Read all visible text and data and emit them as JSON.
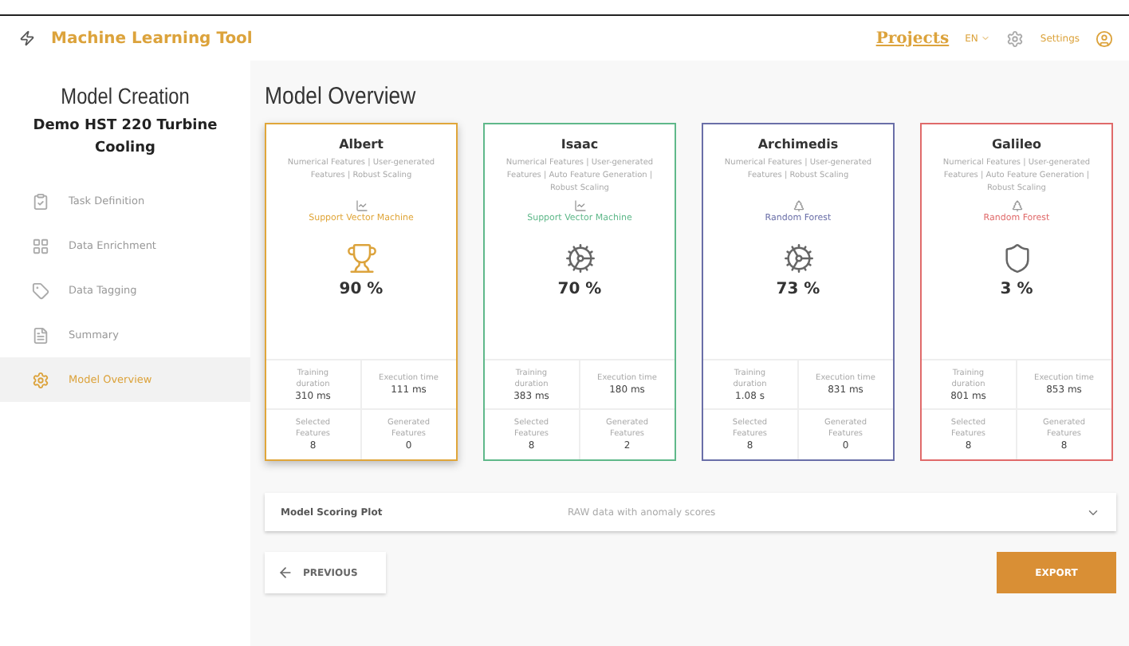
{
  "app": {
    "title": "Machine Learning Tool"
  },
  "header": {
    "projects_link": "Projects",
    "language": "EN",
    "settings": "Settings"
  },
  "sidebar": {
    "title": "Model Creation",
    "project": "Demo HST 220 Turbine Cooling",
    "items": [
      {
        "label": "Task Definition",
        "selected": false
      },
      {
        "label": "Data Enrichment",
        "selected": false
      },
      {
        "label": "Data Tagging",
        "selected": false
      },
      {
        "label": "Summary",
        "selected": false
      },
      {
        "label": "Model Overview",
        "selected": true
      }
    ]
  },
  "page_title": "Model Overview",
  "models": [
    {
      "name": "Albert",
      "features": "Numerical Features | User-generated Features | Robust Scaling",
      "algorithm": "Support Vector Machine",
      "score": "90 %",
      "color": "#e0a63a",
      "selected": true,
      "metrics": [
        {
          "label": "Training duration",
          "value": "310 ms"
        },
        {
          "label": "Execution time",
          "value": "111 ms"
        },
        {
          "label": "Selected Features",
          "value": "8"
        },
        {
          "label": "Generated Features",
          "value": "0"
        }
      ]
    },
    {
      "name": "Isaac",
      "features": "Numerical Features | User-generated Features | Auto Feature Generation | Robust Scaling",
      "algorithm": "Support Vector Machine",
      "score": "70 %",
      "color": "#5fb88a",
      "selected": false,
      "metrics": [
        {
          "label": "Training duration",
          "value": "383 ms"
        },
        {
          "label": "Execution time",
          "value": "180 ms"
        },
        {
          "label": "Selected Features",
          "value": "8"
        },
        {
          "label": "Generated Features",
          "value": "2"
        }
      ]
    },
    {
      "name": "Archimedis",
      "features": "Numerical Features | User-generated Features | Robust Scaling",
      "algorithm": "Random Forest",
      "score": "73 %",
      "color": "#6a6fa8",
      "selected": false,
      "metrics": [
        {
          "label": "Training duration",
          "value": "1.08 s"
        },
        {
          "label": "Execution time",
          "value": "831 ms"
        },
        {
          "label": "Selected Features",
          "value": "8"
        },
        {
          "label": "Generated Features",
          "value": "0"
        }
      ]
    },
    {
      "name": "Galileo",
      "features": "Numerical Features | User-generated Features | Auto Feature Generation | Robust Scaling",
      "algorithm": "Random Forest",
      "score": "3 %",
      "color": "#e06a6a",
      "selected": false,
      "metrics": [
        {
          "label": "Training duration",
          "value": "801 ms"
        },
        {
          "label": "Execution time",
          "value": "853 ms"
        },
        {
          "label": "Selected Features",
          "value": "8"
        },
        {
          "label": "Generated Features",
          "value": "8"
        }
      ]
    }
  ],
  "scoring_plot": {
    "label": "Model Scoring Plot",
    "value": "RAW data with anomaly scores",
    "expanded": false
  },
  "buttons": {
    "previous": "PREVIOUS",
    "export": "EXPORT"
  }
}
